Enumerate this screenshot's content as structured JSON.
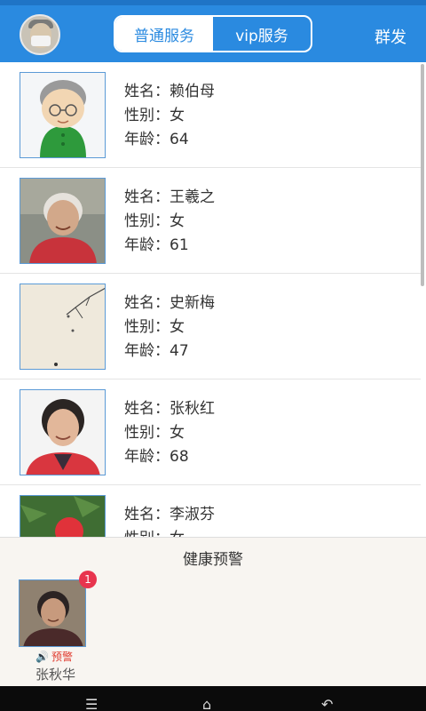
{
  "header": {
    "tabs": [
      "普通服务",
      "vip服务"
    ],
    "send_label": "群发"
  },
  "list": {
    "items": [
      {
        "name_line": "姓名：赖伯母",
        "gender_line": "性别：女",
        "age_line": "年龄：64"
      },
      {
        "name_line": "姓名：王羲之",
        "gender_line": "性别：女",
        "age_line": "年龄：61"
      },
      {
        "name_line": "姓名：史新梅",
        "gender_line": "性别：女",
        "age_line": "年龄：47"
      },
      {
        "name_line": "姓名：张秋红",
        "gender_line": "性别：女",
        "age_line": "年龄：68"
      },
      {
        "name_line": "姓名：李淑芬",
        "gender_line": "性别：女",
        "age_line": ""
      }
    ]
  },
  "warning": {
    "title": "健康预警",
    "badge_count": "1",
    "label": "预警",
    "name": "张秋华"
  },
  "colors": {
    "primary": "#2a8ae0",
    "badge": "#e8344e",
    "warning_text": "#e03a2e"
  }
}
